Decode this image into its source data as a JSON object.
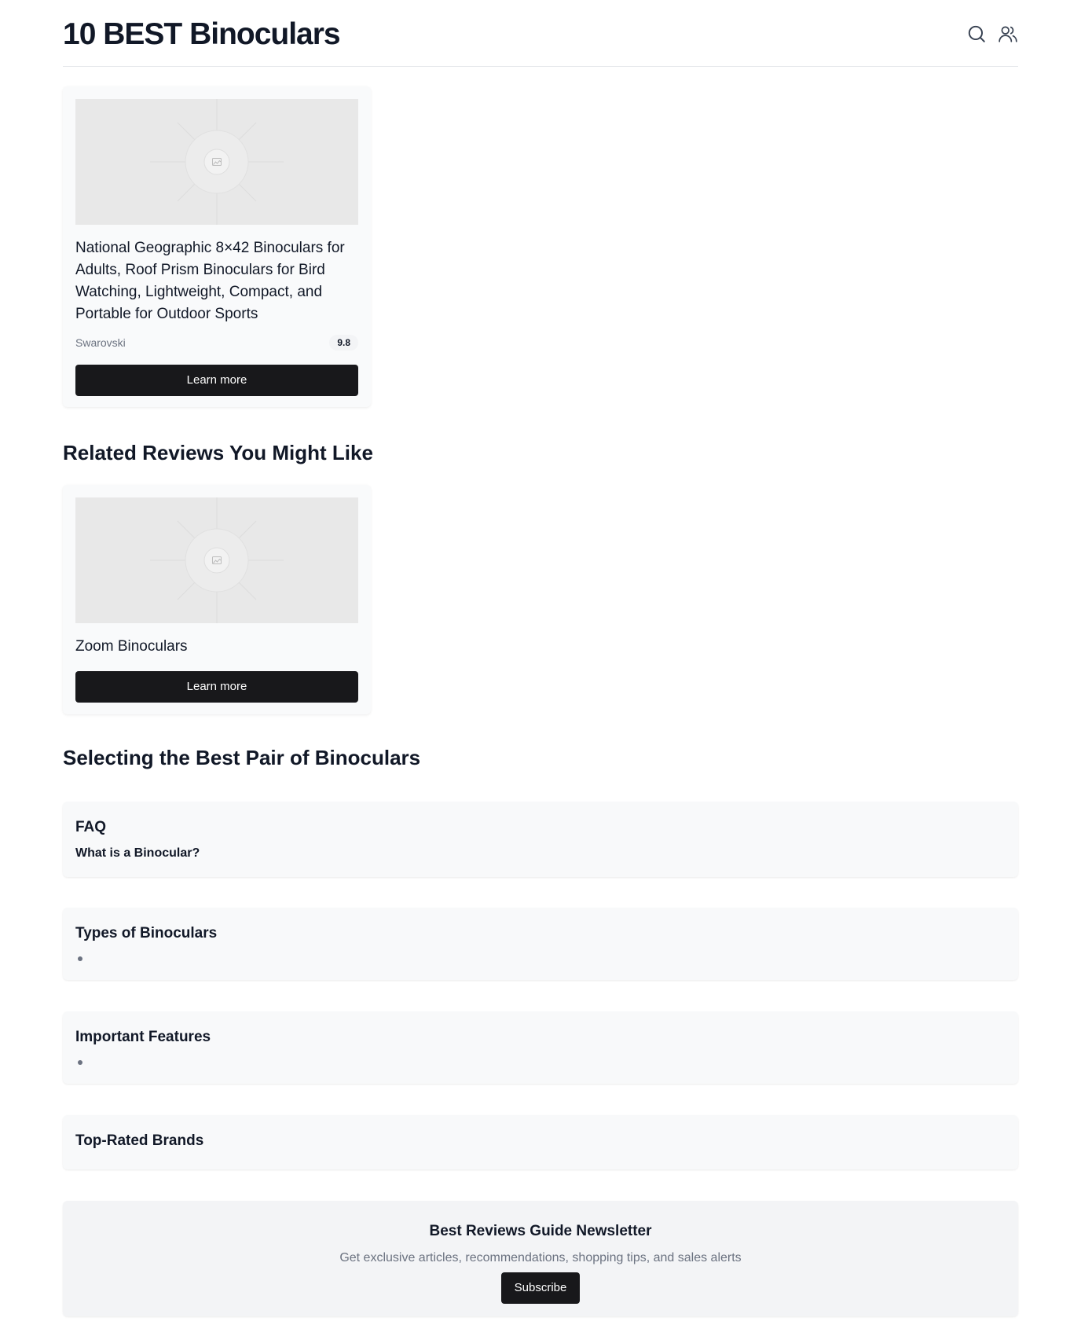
{
  "header": {
    "title": "10 BEST Binoculars",
    "icons": [
      "search-icon",
      "users-icon"
    ]
  },
  "products": [
    {
      "title": "National Geographic 8×42 Binoculars for Adults, Roof Prism Binoculars for Bird Watching, Lightweight, Compact, and Portable for Outdoor Sports",
      "brand": "Swarovski",
      "rating": "9.8",
      "button_label": "Learn more",
      "image_icon": "image-placeholder-icon"
    }
  ],
  "related": {
    "heading": "Related Reviews You Might Like",
    "items": [
      {
        "title": "Zoom Binoculars",
        "button_label": "Learn more",
        "image_icon": "image-placeholder-icon"
      }
    ]
  },
  "guide": {
    "heading": "Selecting the Best Pair of Binoculars",
    "faq": {
      "title": "FAQ",
      "question": "What is a Binocular?"
    },
    "types": {
      "title": "Types of Binoculars"
    },
    "features": {
      "title": "Important Features"
    },
    "brands": {
      "title": "Top-Rated Brands"
    }
  },
  "newsletter": {
    "title": "Best Reviews Guide Newsletter",
    "text": "Get exclusive articles, recommendations, shopping tips, and sales alerts",
    "button_label": "Subscribe"
  },
  "colors": {
    "button_bg": "#18181b",
    "panel_bg": "#f8f9fa",
    "image_placeholder": "#e8e8e8",
    "muted_text": "#6b7280"
  }
}
